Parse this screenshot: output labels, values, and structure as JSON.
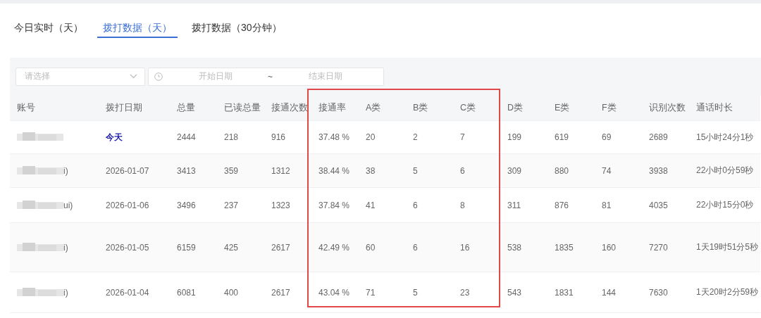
{
  "tabs": [
    {
      "label": "今日实时（天）",
      "selected": false
    },
    {
      "label": "拨打数据（天）",
      "selected": true
    },
    {
      "label": "拨打数据（30分钟）",
      "selected": false
    }
  ],
  "filters": {
    "select": {
      "placeholder": "请选择"
    },
    "date_range": {
      "start_placeholder": "开始日期",
      "separator": "~",
      "end_placeholder": "结束日期"
    }
  },
  "table": {
    "columns": [
      {
        "label": "账号",
        "highlighted": false
      },
      {
        "label": "拨打日期",
        "highlighted": false
      },
      {
        "label": "总量",
        "highlighted": false
      },
      {
        "label": "已读总量",
        "highlighted": false
      },
      {
        "label": "接通次数",
        "highlighted": false
      },
      {
        "label": "接通率",
        "highlighted": true
      },
      {
        "label": "A类",
        "highlighted": true
      },
      {
        "label": "B类",
        "highlighted": true
      },
      {
        "label": "C类",
        "highlighted": true
      },
      {
        "label": "D类",
        "highlighted": false
      },
      {
        "label": "E类",
        "highlighted": false
      },
      {
        "label": "F类",
        "highlighted": false
      },
      {
        "label": "识别次数",
        "highlighted": false
      },
      {
        "label": "通话时长",
        "highlighted": false
      }
    ],
    "rows": [
      {
        "today": true,
        "cells": [
          "",
          "今天",
          "2444",
          "218",
          "916",
          "37.48 %",
          "20",
          "2",
          "7",
          "199",
          "619",
          "69",
          "2689",
          "15小时24分1秒"
        ]
      },
      {
        "today": false,
        "cells": [
          "i)",
          "2026-01-07",
          "3413",
          "359",
          "1312",
          "38.44 %",
          "38",
          "5",
          "6",
          "309",
          "880",
          "74",
          "3938",
          "22小时0分59秒"
        ]
      },
      {
        "today": false,
        "cells": [
          "ui)",
          "2026-01-06",
          "3496",
          "237",
          "1323",
          "37.84 %",
          "41",
          "6",
          "8",
          "311",
          "876",
          "81",
          "4035",
          "22小时15分0秒"
        ]
      },
      {
        "today": false,
        "cells": [
          "i)",
          "2026-01-05",
          "6159",
          "425",
          "2617",
          "42.49 %",
          "60",
          "6",
          "16",
          "538",
          "1835",
          "160",
          "7270",
          "1天19时51分5秒"
        ]
      },
      {
        "today": false,
        "cells": [
          "i)",
          "2026-01-04",
          "6081",
          "400",
          "2617",
          "43.04 %",
          "71",
          "5",
          "23",
          "543",
          "1831",
          "144",
          "7630",
          "1天20时2分59秒"
        ]
      }
    ]
  }
}
